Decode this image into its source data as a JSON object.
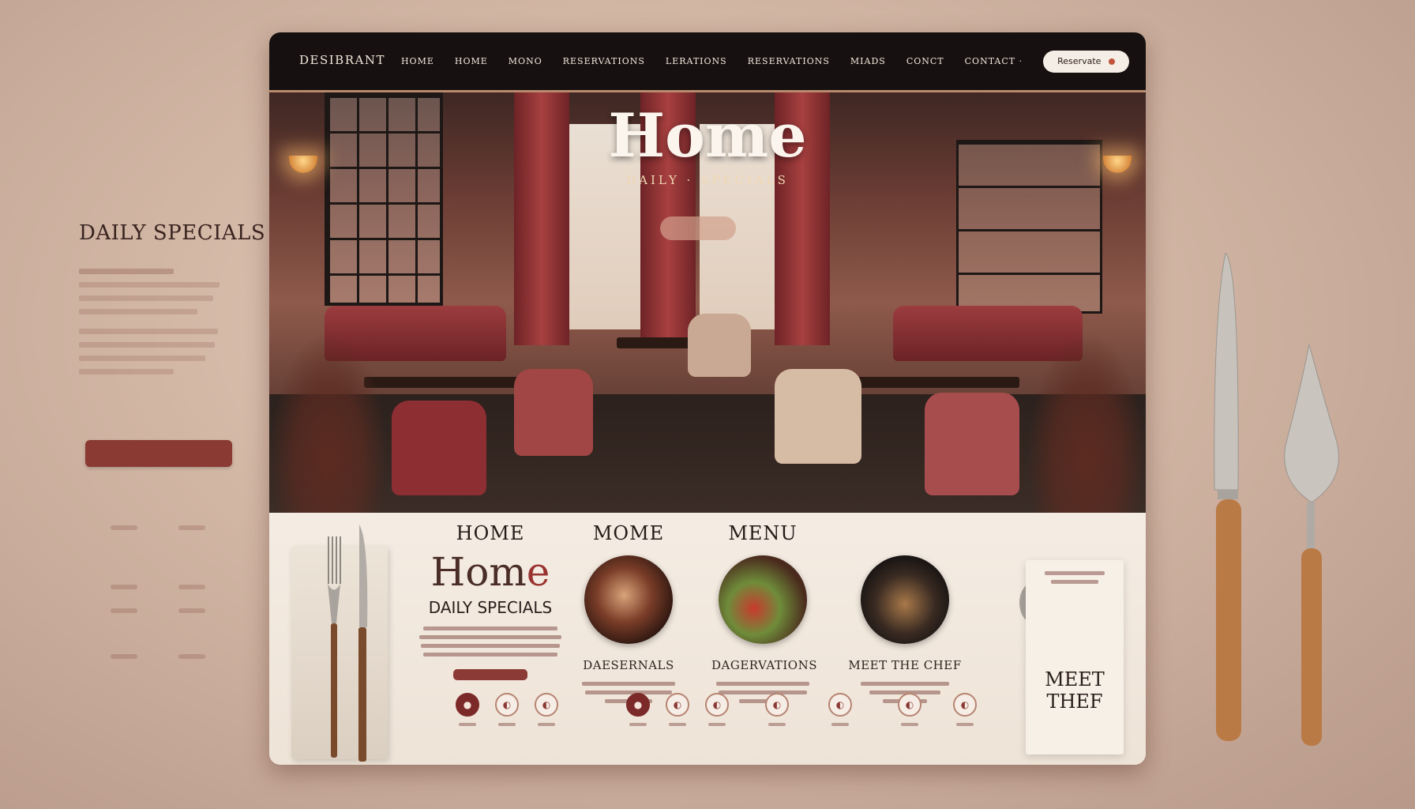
{
  "left_panel": {
    "title": "DAILY SPECIALS",
    "button_label": ""
  },
  "nav": {
    "brand": "DESIBRANT",
    "brand_sub": "",
    "links": [
      "HOME",
      "HOME",
      "MONO",
      "RESERVATIONS",
      "LERATIONS",
      "RESERVATIONS",
      "MIADS",
      "CONCT",
      "CONTACT ·"
    ],
    "cta_label": "Reservate"
  },
  "hero": {
    "title": "Home",
    "subtitle": "DAILY · SPECIALS"
  },
  "sections": {
    "col1": {
      "heading": "HOME",
      "big": "Home",
      "sub": "DAILY SPECIALS"
    },
    "col2": {
      "heading": "MOME",
      "caption": "DAESERNALS"
    },
    "col3": {
      "heading": "MENU",
      "caption": "DAGERVATIONS"
    },
    "col4": {
      "heading": "",
      "caption": "MEET THE CHEF"
    },
    "col5": {
      "title": "MEET THEF"
    }
  },
  "colors": {
    "accent": "#8c3a35",
    "nav_bg": "#161110",
    "page_bg": "#d2b6a4",
    "card_bg": "#efe6dc"
  },
  "icons": [
    "fork-icon",
    "knife-icon",
    "spoon-icon",
    "plate-icon",
    "lamp-icon"
  ]
}
